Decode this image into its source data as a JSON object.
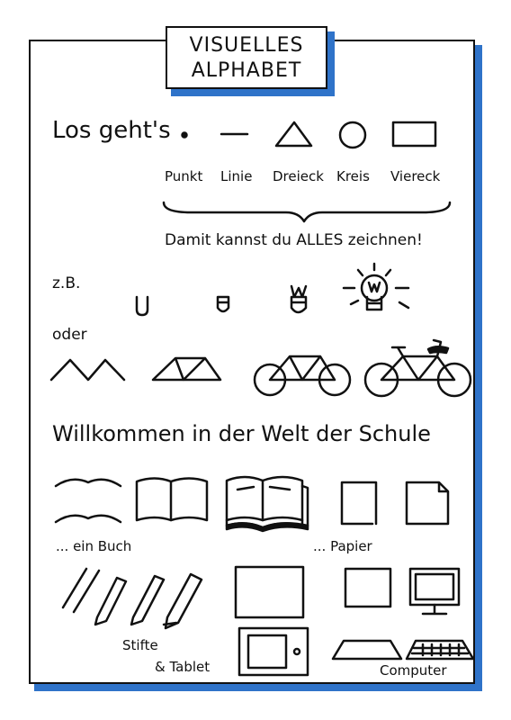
{
  "title": {
    "line1": "VISUELLES",
    "line2": "ALPHABET"
  },
  "intro": {
    "heading": "Los geht's"
  },
  "shapes": [
    {
      "label": "Punkt",
      "icon": "dot-icon"
    },
    {
      "label": "Linie",
      "icon": "line-icon"
    },
    {
      "label": "Dreieck",
      "icon": "triangle-icon"
    },
    {
      "label": "Kreis",
      "icon": "circle-icon"
    },
    {
      "label": "Viereck",
      "icon": "square-icon"
    }
  ],
  "tagline": "Damit kannst du ALLES zeichnen!",
  "example": {
    "zb": "z.B.",
    "oder": "oder"
  },
  "section2": {
    "heading": "Willkommen in der Welt der Schule"
  },
  "school": {
    "book": "... ein Buch",
    "paper": "... Papier",
    "pencils": "Stifte",
    "tablet": "& Tablet",
    "computer": "Computer"
  },
  "colors": {
    "accent": "#2f73c9",
    "ink": "#111111"
  }
}
